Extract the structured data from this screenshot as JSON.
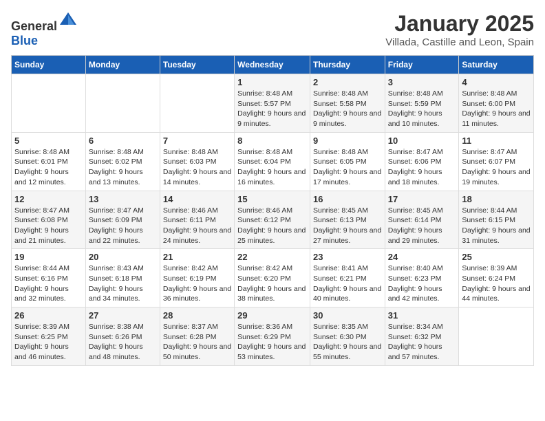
{
  "logo": {
    "text_general": "General",
    "text_blue": "Blue"
  },
  "header": {
    "month_title": "January 2025",
    "location": "Villada, Castille and Leon, Spain"
  },
  "weekdays": [
    "Sunday",
    "Monday",
    "Tuesday",
    "Wednesday",
    "Thursday",
    "Friday",
    "Saturday"
  ],
  "weeks": [
    [
      {
        "day": "",
        "sunrise": "",
        "sunset": "",
        "daylight": ""
      },
      {
        "day": "",
        "sunrise": "",
        "sunset": "",
        "daylight": ""
      },
      {
        "day": "",
        "sunrise": "",
        "sunset": "",
        "daylight": ""
      },
      {
        "day": "1",
        "sunrise": "Sunrise: 8:48 AM",
        "sunset": "Sunset: 5:57 PM",
        "daylight": "Daylight: 9 hours and 9 minutes."
      },
      {
        "day": "2",
        "sunrise": "Sunrise: 8:48 AM",
        "sunset": "Sunset: 5:58 PM",
        "daylight": "Daylight: 9 hours and 9 minutes."
      },
      {
        "day": "3",
        "sunrise": "Sunrise: 8:48 AM",
        "sunset": "Sunset: 5:59 PM",
        "daylight": "Daylight: 9 hours and 10 minutes."
      },
      {
        "day": "4",
        "sunrise": "Sunrise: 8:48 AM",
        "sunset": "Sunset: 6:00 PM",
        "daylight": "Daylight: 9 hours and 11 minutes."
      }
    ],
    [
      {
        "day": "5",
        "sunrise": "Sunrise: 8:48 AM",
        "sunset": "Sunset: 6:01 PM",
        "daylight": "Daylight: 9 hours and 12 minutes."
      },
      {
        "day": "6",
        "sunrise": "Sunrise: 8:48 AM",
        "sunset": "Sunset: 6:02 PM",
        "daylight": "Daylight: 9 hours and 13 minutes."
      },
      {
        "day": "7",
        "sunrise": "Sunrise: 8:48 AM",
        "sunset": "Sunset: 6:03 PM",
        "daylight": "Daylight: 9 hours and 14 minutes."
      },
      {
        "day": "8",
        "sunrise": "Sunrise: 8:48 AM",
        "sunset": "Sunset: 6:04 PM",
        "daylight": "Daylight: 9 hours and 16 minutes."
      },
      {
        "day": "9",
        "sunrise": "Sunrise: 8:48 AM",
        "sunset": "Sunset: 6:05 PM",
        "daylight": "Daylight: 9 hours and 17 minutes."
      },
      {
        "day": "10",
        "sunrise": "Sunrise: 8:47 AM",
        "sunset": "Sunset: 6:06 PM",
        "daylight": "Daylight: 9 hours and 18 minutes."
      },
      {
        "day": "11",
        "sunrise": "Sunrise: 8:47 AM",
        "sunset": "Sunset: 6:07 PM",
        "daylight": "Daylight: 9 hours and 19 minutes."
      }
    ],
    [
      {
        "day": "12",
        "sunrise": "Sunrise: 8:47 AM",
        "sunset": "Sunset: 6:08 PM",
        "daylight": "Daylight: 9 hours and 21 minutes."
      },
      {
        "day": "13",
        "sunrise": "Sunrise: 8:47 AM",
        "sunset": "Sunset: 6:09 PM",
        "daylight": "Daylight: 9 hours and 22 minutes."
      },
      {
        "day": "14",
        "sunrise": "Sunrise: 8:46 AM",
        "sunset": "Sunset: 6:11 PM",
        "daylight": "Daylight: 9 hours and 24 minutes."
      },
      {
        "day": "15",
        "sunrise": "Sunrise: 8:46 AM",
        "sunset": "Sunset: 6:12 PM",
        "daylight": "Daylight: 9 hours and 25 minutes."
      },
      {
        "day": "16",
        "sunrise": "Sunrise: 8:45 AM",
        "sunset": "Sunset: 6:13 PM",
        "daylight": "Daylight: 9 hours and 27 minutes."
      },
      {
        "day": "17",
        "sunrise": "Sunrise: 8:45 AM",
        "sunset": "Sunset: 6:14 PM",
        "daylight": "Daylight: 9 hours and 29 minutes."
      },
      {
        "day": "18",
        "sunrise": "Sunrise: 8:44 AM",
        "sunset": "Sunset: 6:15 PM",
        "daylight": "Daylight: 9 hours and 31 minutes."
      }
    ],
    [
      {
        "day": "19",
        "sunrise": "Sunrise: 8:44 AM",
        "sunset": "Sunset: 6:16 PM",
        "daylight": "Daylight: 9 hours and 32 minutes."
      },
      {
        "day": "20",
        "sunrise": "Sunrise: 8:43 AM",
        "sunset": "Sunset: 6:18 PM",
        "daylight": "Daylight: 9 hours and 34 minutes."
      },
      {
        "day": "21",
        "sunrise": "Sunrise: 8:42 AM",
        "sunset": "Sunset: 6:19 PM",
        "daylight": "Daylight: 9 hours and 36 minutes."
      },
      {
        "day": "22",
        "sunrise": "Sunrise: 8:42 AM",
        "sunset": "Sunset: 6:20 PM",
        "daylight": "Daylight: 9 hours and 38 minutes."
      },
      {
        "day": "23",
        "sunrise": "Sunrise: 8:41 AM",
        "sunset": "Sunset: 6:21 PM",
        "daylight": "Daylight: 9 hours and 40 minutes."
      },
      {
        "day": "24",
        "sunrise": "Sunrise: 8:40 AM",
        "sunset": "Sunset: 6:23 PM",
        "daylight": "Daylight: 9 hours and 42 minutes."
      },
      {
        "day": "25",
        "sunrise": "Sunrise: 8:39 AM",
        "sunset": "Sunset: 6:24 PM",
        "daylight": "Daylight: 9 hours and 44 minutes."
      }
    ],
    [
      {
        "day": "26",
        "sunrise": "Sunrise: 8:39 AM",
        "sunset": "Sunset: 6:25 PM",
        "daylight": "Daylight: 9 hours and 46 minutes."
      },
      {
        "day": "27",
        "sunrise": "Sunrise: 8:38 AM",
        "sunset": "Sunset: 6:26 PM",
        "daylight": "Daylight: 9 hours and 48 minutes."
      },
      {
        "day": "28",
        "sunrise": "Sunrise: 8:37 AM",
        "sunset": "Sunset: 6:28 PM",
        "daylight": "Daylight: 9 hours and 50 minutes."
      },
      {
        "day": "29",
        "sunrise": "Sunrise: 8:36 AM",
        "sunset": "Sunset: 6:29 PM",
        "daylight": "Daylight: 9 hours and 53 minutes."
      },
      {
        "day": "30",
        "sunrise": "Sunrise: 8:35 AM",
        "sunset": "Sunset: 6:30 PM",
        "daylight": "Daylight: 9 hours and 55 minutes."
      },
      {
        "day": "31",
        "sunrise": "Sunrise: 8:34 AM",
        "sunset": "Sunset: 6:32 PM",
        "daylight": "Daylight: 9 hours and 57 minutes."
      },
      {
        "day": "",
        "sunrise": "",
        "sunset": "",
        "daylight": ""
      }
    ]
  ]
}
